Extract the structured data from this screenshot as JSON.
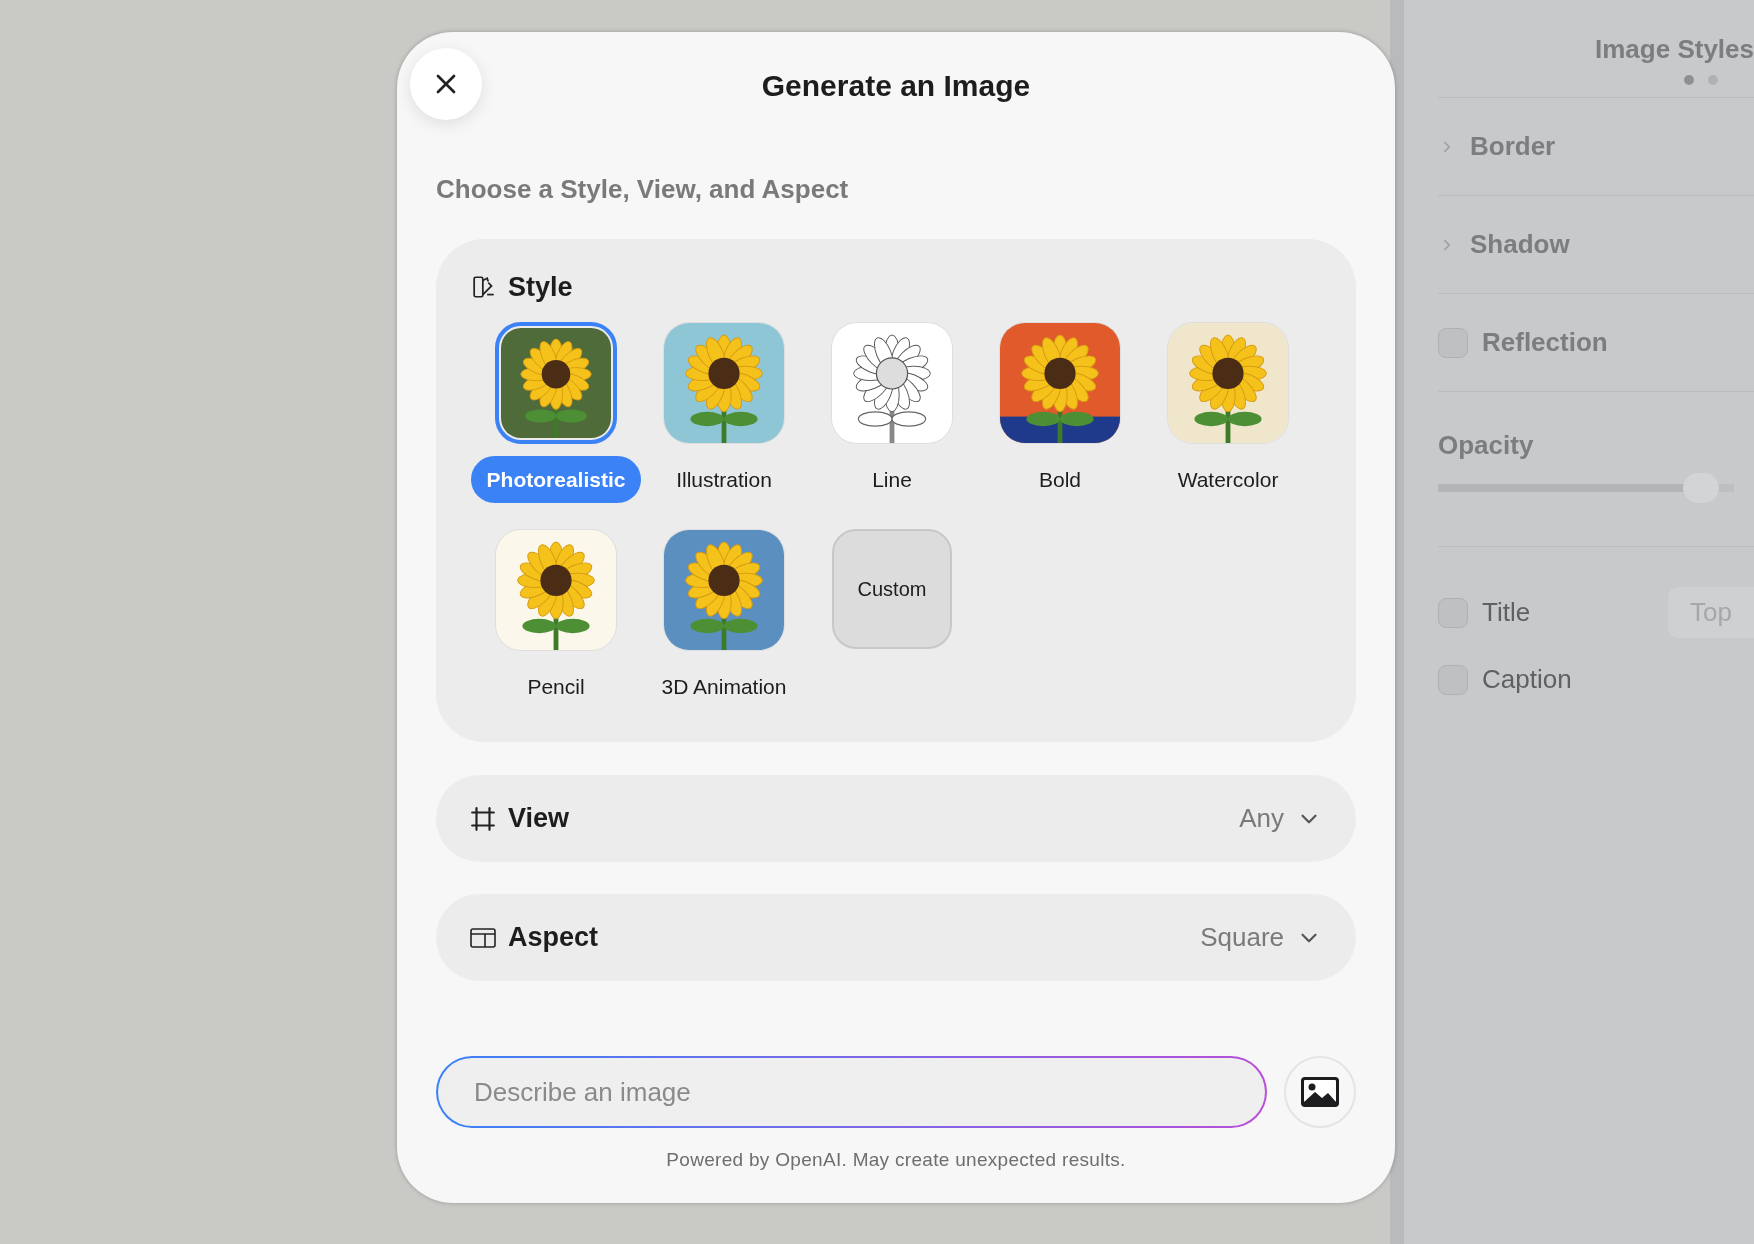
{
  "dialog": {
    "title": "Generate an Image",
    "subtitle": "Choose a Style, View, and Aspect",
    "style": {
      "label": "Style",
      "options": [
        {
          "kind": "image",
          "label": "Photorealistic",
          "selected": true
        },
        {
          "kind": "image",
          "label": "Illustration",
          "selected": false
        },
        {
          "kind": "image",
          "label": "Line",
          "selected": false
        },
        {
          "kind": "image",
          "label": "Bold",
          "selected": false
        },
        {
          "kind": "image",
          "label": "Watercolor",
          "selected": false
        },
        {
          "kind": "image",
          "label": "Pencil",
          "selected": false
        },
        {
          "kind": "image",
          "label": "3D Animation",
          "selected": false
        },
        {
          "kind": "custom",
          "label": "Custom",
          "selected": false
        }
      ]
    },
    "view": {
      "label": "View",
      "value": "Any"
    },
    "aspect": {
      "label": "Aspect",
      "value": "Square"
    },
    "prompt": {
      "placeholder": "Describe an image"
    },
    "footer": "Powered by OpenAI. May create unexpected results."
  },
  "sidebar": {
    "title": "Image Styles",
    "rows": [
      {
        "kind": "disclosure",
        "label": "Border"
      },
      {
        "kind": "disclosure",
        "label": "Shadow"
      },
      {
        "kind": "checkbox",
        "label": "Reflection",
        "checked": false
      },
      {
        "kind": "slider",
        "label": "Opacity",
        "level": 0.95
      },
      {
        "kind": "checks",
        "items": [
          {
            "label": "Title",
            "checked": false,
            "value": "Top"
          },
          {
            "label": "Caption",
            "checked": false
          }
        ]
      }
    ]
  }
}
